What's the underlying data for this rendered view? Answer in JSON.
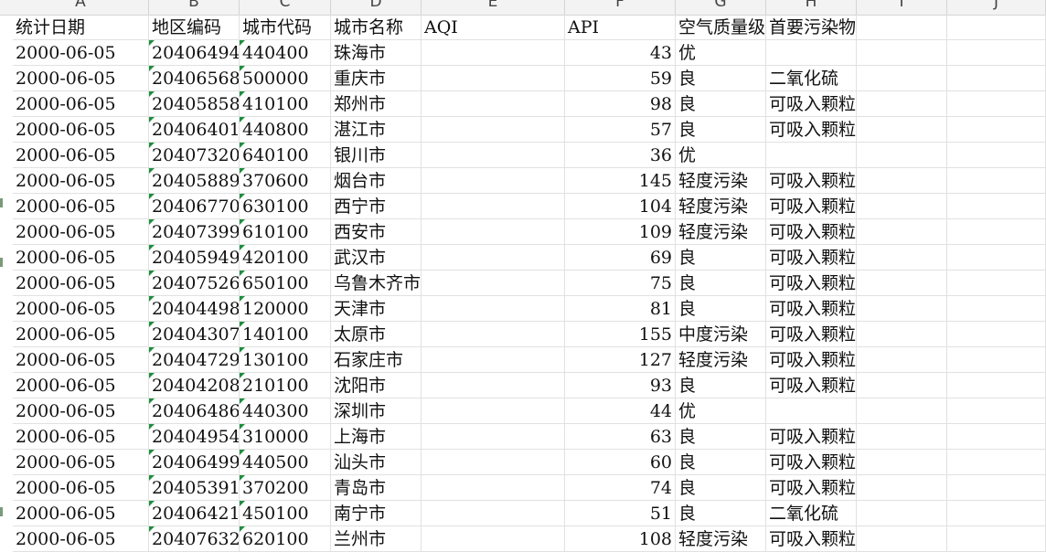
{
  "columns": [
    "A",
    "B",
    "C",
    "D",
    "E",
    "F",
    "G",
    "H",
    "I",
    "J"
  ],
  "header": [
    "统计日期",
    "地区编码",
    "城市代码",
    "城市名称",
    "AQI",
    "API",
    "空气质量级别",
    "首要污染物"
  ],
  "rows": [
    [
      "2000-06-05",
      "20406494",
      "440400",
      "珠海市",
      "",
      "43",
      "优",
      ""
    ],
    [
      "2000-06-05",
      "20406568",
      "500000",
      "重庆市",
      "",
      "59",
      "良",
      "二氧化硫"
    ],
    [
      "2000-06-05",
      "20405858",
      "410100",
      "郑州市",
      "",
      "98",
      "良",
      "可吸入颗粒物"
    ],
    [
      "2000-06-05",
      "20406401",
      "440800",
      "湛江市",
      "",
      "57",
      "良",
      "可吸入颗粒物"
    ],
    [
      "2000-06-05",
      "20407320",
      "640100",
      "银川市",
      "",
      "36",
      "优",
      ""
    ],
    [
      "2000-06-05",
      "20405889",
      "370600",
      "烟台市",
      "",
      "145",
      "轻度污染",
      "可吸入颗粒物"
    ],
    [
      "2000-06-05",
      "20406770",
      "630100",
      "西宁市",
      "",
      "104",
      "轻度污染",
      "可吸入颗粒物"
    ],
    [
      "2000-06-05",
      "20407399",
      "610100",
      "西安市",
      "",
      "109",
      "轻度污染",
      "可吸入颗粒物"
    ],
    [
      "2000-06-05",
      "20405949",
      "420100",
      "武汉市",
      "",
      "69",
      "良",
      "可吸入颗粒物"
    ],
    [
      "2000-06-05",
      "20407526",
      "650100",
      "乌鲁木齐市",
      "",
      "75",
      "良",
      "可吸入颗粒物"
    ],
    [
      "2000-06-05",
      "20404498",
      "120000",
      "天津市",
      "",
      "81",
      "良",
      "可吸入颗粒物"
    ],
    [
      "2000-06-05",
      "20404307",
      "140100",
      "太原市",
      "",
      "155",
      "中度污染",
      "可吸入颗粒物"
    ],
    [
      "2000-06-05",
      "20404729",
      "130100",
      "石家庄市",
      "",
      "127",
      "轻度污染",
      "可吸入颗粒物"
    ],
    [
      "2000-06-05",
      "20404208",
      "210100",
      "沈阳市",
      "",
      "93",
      "良",
      "可吸入颗粒物"
    ],
    [
      "2000-06-05",
      "20406486",
      "440300",
      "深圳市",
      "",
      "44",
      "优",
      ""
    ],
    [
      "2000-06-05",
      "20404954",
      "310000",
      "上海市",
      "",
      "63",
      "良",
      "可吸入颗粒物"
    ],
    [
      "2000-06-05",
      "20406499",
      "440500",
      "汕头市",
      "",
      "60",
      "良",
      "可吸入颗粒物"
    ],
    [
      "2000-06-05",
      "20405391",
      "370200",
      "青岛市",
      "",
      "74",
      "良",
      "可吸入颗粒物"
    ],
    [
      "2000-06-05",
      "20406421",
      "450100",
      "南宁市",
      "",
      "51",
      "良",
      "二氧化硫"
    ],
    [
      "2000-06-05",
      "20407632",
      "620100",
      "兰州市",
      "",
      "108",
      "轻度污染",
      "可吸入颗粒物"
    ]
  ]
}
